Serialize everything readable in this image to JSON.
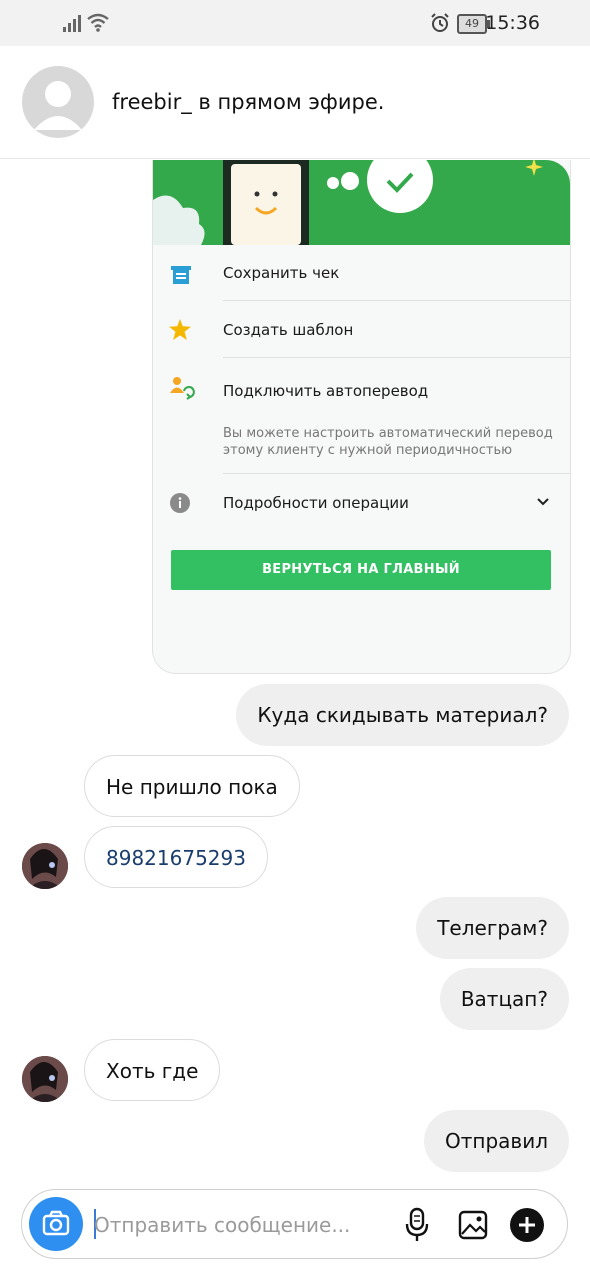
{
  "status_bar": {
    "time": "15:36",
    "battery": "49",
    "icons": [
      "signal-icon",
      "wifi-icon",
      "alarm-icon",
      "battery-icon"
    ]
  },
  "header": {
    "username": "freebir_",
    "status": "в прямом эфире."
  },
  "receipt_card": {
    "save_receipt": "Сохранить чек",
    "create_template": "Создать шаблон",
    "connect_autotransfer": "Подключить автоперевод",
    "autotransfer_note": "Вы можете настроить автоматический перевод этому клиенту с нужной периодичностью",
    "operation_details": "Подробности операции",
    "back_button": "ВЕРНУТЬСЯ НА ГЛАВНЫЙ",
    "brand_green": "#33a94c",
    "button_green": "#33c062"
  },
  "messages": [
    {
      "direction": "outgoing",
      "text": "Куда скидывать материал?"
    },
    {
      "direction": "incoming",
      "text": "Не пришло пока"
    },
    {
      "direction": "incoming",
      "text": "89821675293"
    },
    {
      "direction": "outgoing",
      "text": "Телеграм?"
    },
    {
      "direction": "outgoing",
      "text": "Ватцап?"
    },
    {
      "direction": "incoming",
      "text": "Хоть где"
    },
    {
      "direction": "outgoing",
      "text": "Отправил"
    }
  ],
  "composer": {
    "placeholder": "Отправить сообщение...",
    "accent": "#2f8ff0",
    "icons": [
      "camera-icon",
      "microphone-icon",
      "gallery-icon",
      "plus-icon"
    ]
  }
}
